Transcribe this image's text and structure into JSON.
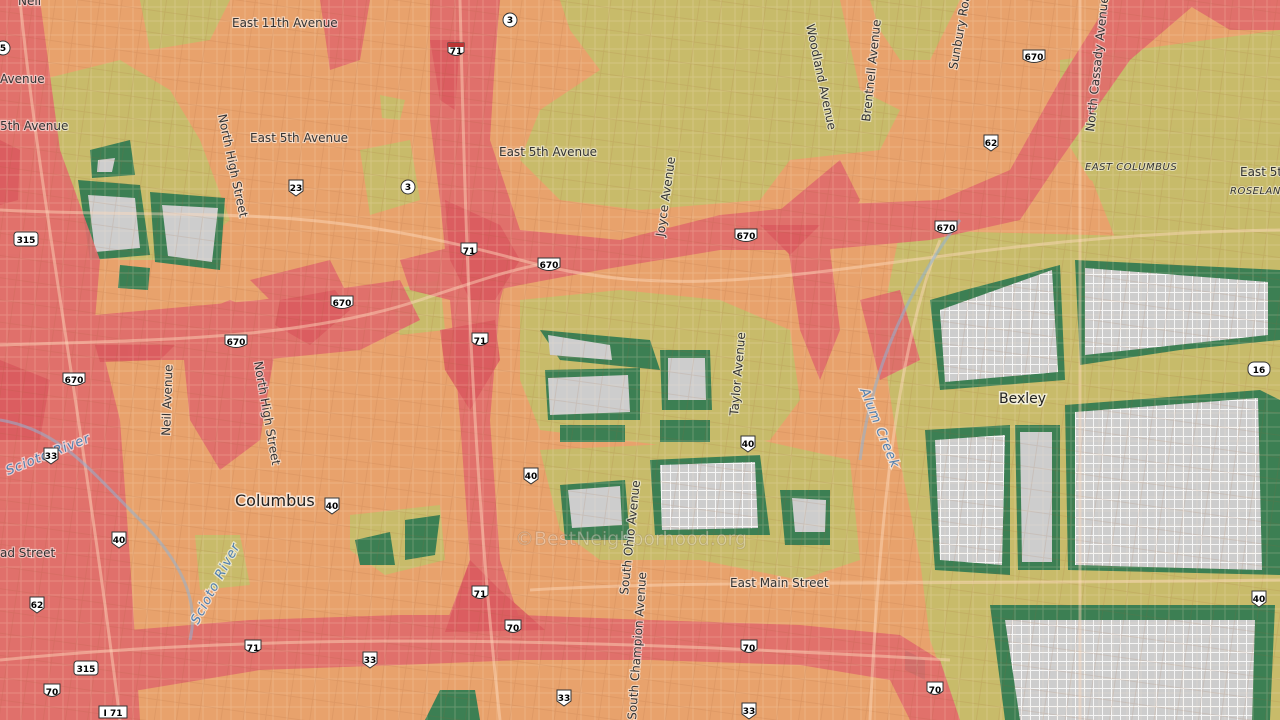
{
  "map": {
    "colors": {
      "base": "#e8a26c",
      "high": "#e26b6b",
      "mid": "#e99a6a",
      "low": "#cbbd6a",
      "verylow": "#b6c25d",
      "minimal": "#3b8055",
      "nodata": "#c9c9c9",
      "water": "#7ea7d1"
    },
    "cities": {
      "columbus": "Columbus",
      "bexley": "Bexley"
    },
    "areas": {
      "east_columbus": "EAST COLUMBUS",
      "roseland": "ROSELAND"
    },
    "water": {
      "scioto_upper": "Scioto River",
      "scioto_lower": "Scioto River",
      "alum_creek": "Alum Creek"
    },
    "streets": {
      "e11": "East 11th Avenue",
      "e5_left": "East 5th Avenue",
      "e5_mid": "East 5th Avenue",
      "e5_left_edge": "5th Avenue",
      "e5_right": "East 5t",
      "n_high_top": "North High Street",
      "n_high_bottom": "North High Street",
      "neil": "Neil Avenue",
      "woodland": "Woodland Avenue",
      "brentnell": "Brentnell Avenue",
      "sunbury": "Sunbury Road",
      "n_cassady": "North Cassady Avenue",
      "joyce": "Joyce Avenue",
      "taylor": "Taylor Avenue",
      "s_ohio": "South Ohio Avenue",
      "s_champion": "South Champion Avenue",
      "e_main": "East Main Street",
      "broad_left": "ad Street",
      "partial_ave": "Avenue",
      "partial_neil_top": "Neil"
    },
    "shields": {
      "i71_top": "71",
      "i71_mid": "71",
      "i71_mid2": "71",
      "i71_bottom": "71",
      "i71_corner": "I 71",
      "i670_a": "670",
      "i670_b": "670",
      "i670_c": "670",
      "i670_d": "670",
      "i670_e": "670",
      "i670_f": "670",
      "i670_g": "670",
      "i70_a": "70",
      "i70_b": "70",
      "i70_c": "70",
      "i70_d": "70",
      "us62_a": "62",
      "us62_b": "62",
      "us23": "23",
      "us33_a": "33",
      "us33_b": "33",
      "us33_c": "33",
      "us33_d": "33",
      "us40_a": "40",
      "us40_b": "40",
      "us40_c": "40",
      "us40_d": "40",
      "us40_e": "40",
      "us315_a": "315",
      "us315_b": "315",
      "sr3_a": "3",
      "sr3_b": "3",
      "sr16": "16",
      "sr5": "5"
    },
    "watermark": "©BestNeighborhood.org"
  }
}
